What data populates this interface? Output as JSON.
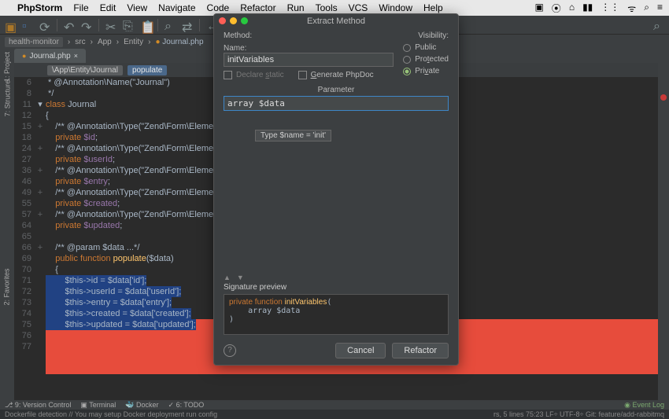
{
  "menubar": {
    "app": "PhpStorm",
    "items": [
      "File",
      "Edit",
      "View",
      "Navigate",
      "Code",
      "Refactor",
      "Run",
      "Tools",
      "VCS",
      "Window",
      "Help"
    ]
  },
  "breadcrumb": {
    "project": "health-monitor",
    "folder1": "src",
    "folder2": "App",
    "folder3": "Entity",
    "file": "Journal.php"
  },
  "tab": {
    "name": "Journal.php"
  },
  "path_segments": {
    "ns": "\\App\\Entity\\Journal",
    "method": "populate"
  },
  "code": {
    "l6": " * @Annotation\\Name(\"Journal\")",
    "l8": " */",
    "l11_pre": "class ",
    "l11_cls": "Journal",
    "l12": "{",
    "l15": "    /** @Annotation\\Type(\"Zend\\Form\\Element\\",
    "l18_pre": "    ",
    "l18_kw": "private ",
    "l18_var": "$id",
    "l18_end": ";",
    "l24": "    /** @Annotation\\Type(\"Zend\\Form\\Element\\",
    "l27_pre": "    ",
    "l27_kw": "private ",
    "l27_var": "$userId",
    "l27_end": ";",
    "l36": "    /** @Annotation\\Type(\"Zend\\Form\\Element\\",
    "l46_pre": "    ",
    "l46_kw": "private ",
    "l46_var": "$entry",
    "l46_end": ";",
    "l49": "    /** @Annotation\\Type(\"Zend\\Form\\Element\\",
    "l55_pre": "    ",
    "l55_kw": "private ",
    "l55_var": "$created",
    "l55_end": ";",
    "l57": "    /** @Annotation\\Type(\"Zend\\Form\\Element\\",
    "l64_pre": "    ",
    "l64_kw": "private ",
    "l64_var": "$updated",
    "l64_end": ";",
    "l66": "    /** @param $data ...*/",
    "l69_pre": "    ",
    "l69_kw": "public function ",
    "l69_fn": "populate",
    "l69_args": "($data)",
    "l70": "    {",
    "l71": "        $this->id = $data['id'];",
    "l72": "        $this->userId = $data['userId'];",
    "l73": "        $this->entry = $data['entry'];",
    "l74": "        $this->created = $data['created'];",
    "l75": "        $this->updated = $data['updated'];",
    "l76": "    }"
  },
  "line_numbers": [
    "6",
    "8",
    "11",
    "12",
    "15",
    "18",
    "24",
    "27",
    "36",
    "46",
    "49",
    "55",
    "57",
    "64",
    "65",
    "66",
    "69",
    "70",
    "71",
    "72",
    "73",
    "74",
    "75",
    "76",
    "77"
  ],
  "dialog": {
    "title": "Extract Method",
    "method_label": "Method:",
    "visibility_label": "Visibility:",
    "name_label": "Name:",
    "name_value": "initVariables",
    "static_label": "Declare static",
    "phpdoc_label": "Generate PhpDoc",
    "vis_public": "Public",
    "vis_protected": "Protected",
    "vis_private": "Private",
    "parameter_header": "Parameter",
    "parameter_value": "array $data",
    "tooltip": "Type $name = 'init'",
    "sig_label": "Signature preview",
    "sig_code": "private function initVariables(\n    array $data\n)",
    "cancel": "Cancel",
    "refactor": "Refactor"
  },
  "leftRail": {
    "project": "1: Project",
    "structure": "7: Structure",
    "favorites": "2: Favorites"
  },
  "status": {
    "vc": "9: Version Control",
    "terminal": "Terminal",
    "docker": "Docker",
    "todo": "6: TODO",
    "event": "Event Log",
    "msg": "Dockerfile detection  // You may setup Docker deployment run config",
    "right": "rs, 5 lines    75:23   LF÷   UTF-8÷   Git: feature/add-rabbitmq"
  }
}
